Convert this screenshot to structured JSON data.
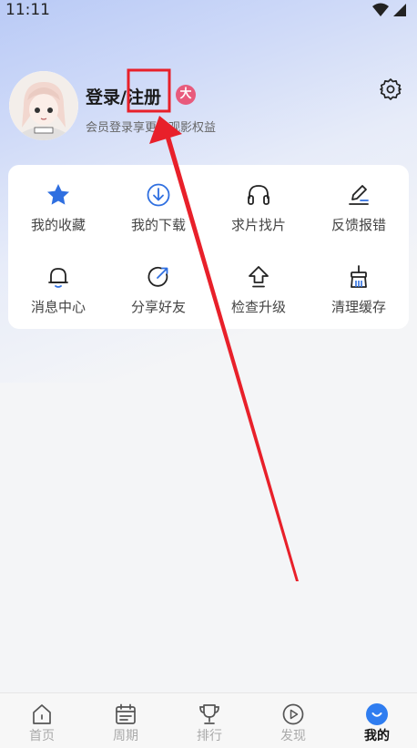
{
  "status": {
    "time": "11:11"
  },
  "profile": {
    "title": "登录/注册",
    "badge": "大",
    "subtitle": "会员登录享更多观影权益"
  },
  "grid": [
    {
      "label": "我的收藏",
      "icon": "star-icon"
    },
    {
      "label": "我的下载",
      "icon": "download-icon"
    },
    {
      "label": "求片找片",
      "icon": "headphones-icon"
    },
    {
      "label": "反馈报错",
      "icon": "edit-icon"
    },
    {
      "label": "消息中心",
      "icon": "bell-icon"
    },
    {
      "label": "分享好友",
      "icon": "share-icon"
    },
    {
      "label": "检查升级",
      "icon": "upgrade-icon"
    },
    {
      "label": "清理缓存",
      "icon": "broom-icon"
    }
  ],
  "tabs": [
    {
      "label": "首页",
      "icon": "home-icon"
    },
    {
      "label": "周期",
      "icon": "calendar-icon"
    },
    {
      "label": "排行",
      "icon": "trophy-icon"
    },
    {
      "label": "发现",
      "icon": "play-icon"
    },
    {
      "label": "我的",
      "icon": "profile-icon"
    }
  ],
  "colors": {
    "accent": "#2f6fe0",
    "badge": "#e85a7c",
    "annotation": "#e8202a"
  }
}
